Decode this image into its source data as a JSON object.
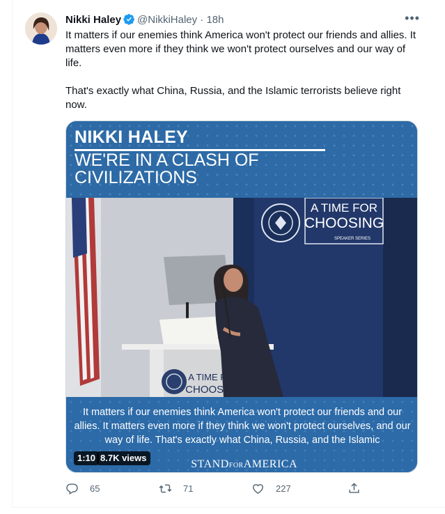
{
  "author": {
    "name": "Nikki Haley",
    "handle": "@NikkiHaley",
    "separator": "·",
    "time": "18h"
  },
  "more_label": "•••",
  "tweet_paragraphs": [
    "It matters if our enemies think America won't protect our friends and allies. It matters even more if they think we won't protect ourselves and our way of life.",
    "That's exactly what China, Russia, and the Islamic terrorists believe right now."
  ],
  "video": {
    "overlay_name": "NIKKI HALEY",
    "overlay_headline": "WE'RE IN A CLASH OF CIVILIZATIONS",
    "backdrop_title": "A TIME FOR CHOOSING",
    "backdrop_subtitle": "SPEAKER SERIES",
    "podium_title": "A TIME FOR CHOOSING",
    "caption": "It matters if our enemies think America won't protect our friends and our allies. It matters even more if they think we won't protect ourselves, and our way of life. That's exactly what China, Russia, and the Islamic",
    "duration": "1:10",
    "views": "8.7K views",
    "brand_1": "STAND",
    "brand_for": "FOR",
    "brand_2": "AMERICA"
  },
  "actions": {
    "replies": "65",
    "retweets": "71",
    "likes": "227"
  },
  "colors": {
    "verified": "#1d9bf0",
    "secondary_text": "#536471",
    "video_blue": "#2c6aa8"
  }
}
